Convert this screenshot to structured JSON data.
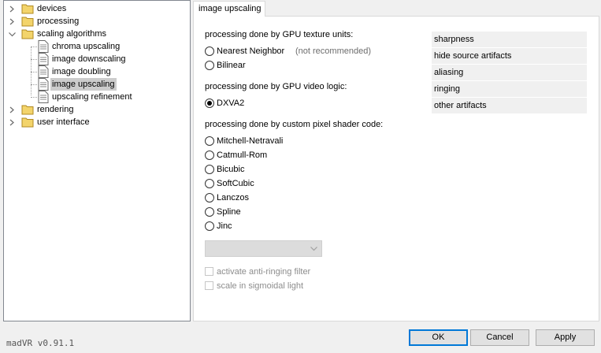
{
  "tree": {
    "items": [
      {
        "label": "devices"
      },
      {
        "label": "processing"
      },
      {
        "label": "scaling algorithms"
      },
      {
        "label": "chroma upscaling"
      },
      {
        "label": "image downscaling"
      },
      {
        "label": "image doubling"
      },
      {
        "label": "image upscaling",
        "selected": true
      },
      {
        "label": "upscaling refinement"
      },
      {
        "label": "rendering"
      },
      {
        "label": "user interface"
      }
    ]
  },
  "tab": {
    "label": "image upscaling"
  },
  "sections": {
    "gpu_texture": "processing done by GPU texture units:",
    "gpu_video": "processing done by GPU video logic:",
    "pixel_shader": "processing done by custom pixel shader code:"
  },
  "options": {
    "nearest_neighbor": "Nearest Neighbor",
    "nearest_hint": "(not recommended)",
    "bilinear": "Bilinear",
    "dxva2": "DXVA2",
    "mitchell": "Mitchell-Netravali",
    "catmull": "Catmull-Rom",
    "bicubic": "Bicubic",
    "softcubic": "SoftCubic",
    "lanczos": "Lanczos",
    "spline": "Spline",
    "jinc": "Jinc",
    "selected": "DXVA2"
  },
  "checkboxes": {
    "anti_ringing": "activate anti-ringing filter",
    "sigmoidal": "scale in sigmoidal light"
  },
  "side_panel": [
    "sharpness",
    "hide source artifacts",
    "aliasing",
    "ringing",
    "other artifacts"
  ],
  "footer": {
    "version": "madVR v0.91.1",
    "ok": "OK",
    "cancel": "Cancel",
    "apply": "Apply"
  },
  "icons": {
    "folder": "folder-icon",
    "page": "settings-page-icon",
    "expand": "chevron-right-icon",
    "collapse": "chevron-down-icon"
  },
  "colors": {
    "accent": "#0078d7",
    "folder": "#f3d46b",
    "selection": "#cccccc"
  }
}
